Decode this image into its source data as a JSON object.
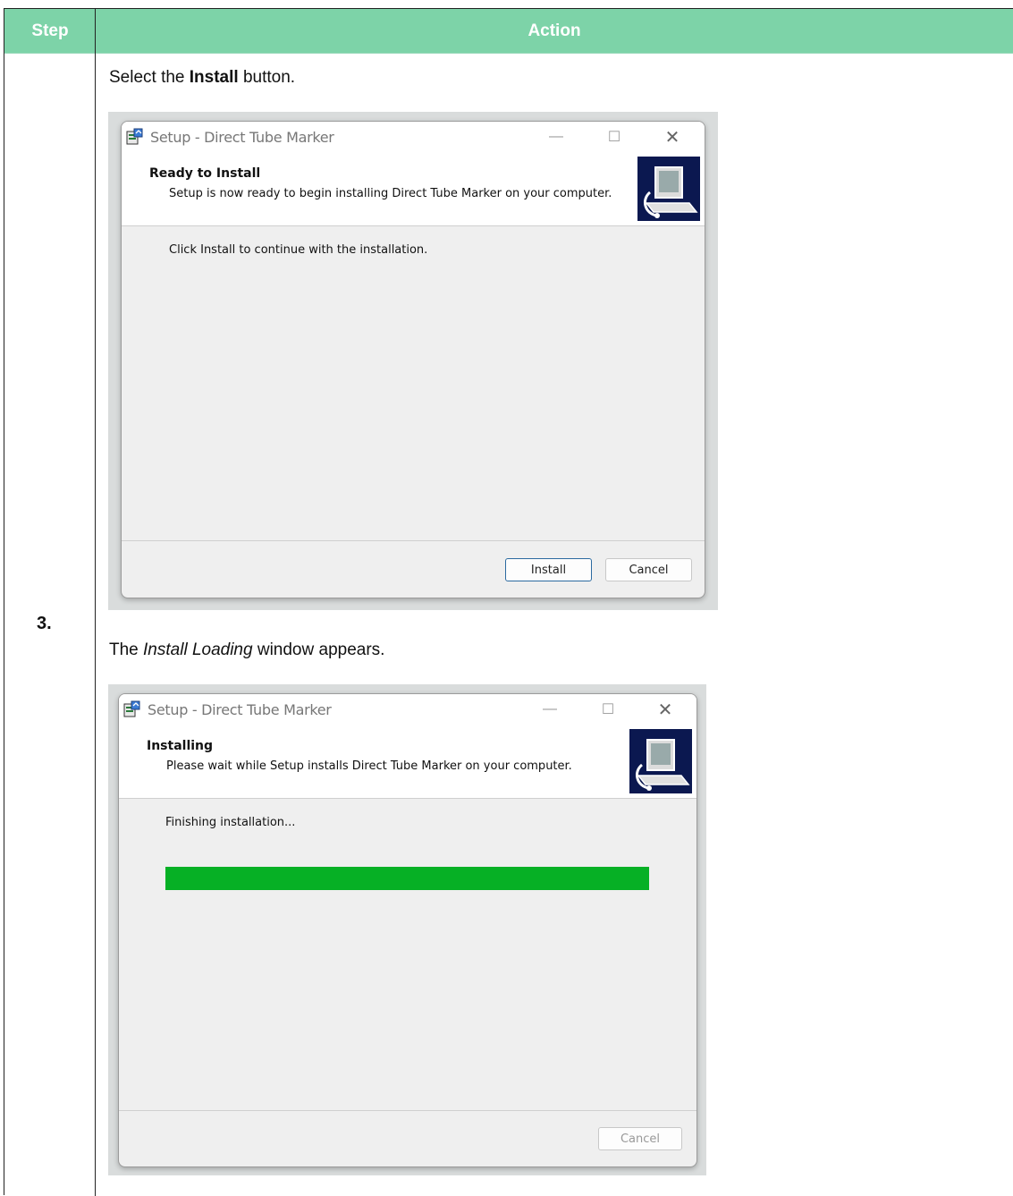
{
  "table": {
    "header_step": "Step",
    "header_action": "Action",
    "step_number": "3."
  },
  "instruction1": {
    "pre": "Select the ",
    "bold": "Install",
    "post": " button."
  },
  "instruction2": {
    "pre": "The ",
    "italic": "Install Loading",
    "post": " window appears."
  },
  "dialog1": {
    "title": "Setup - Direct Tube Marker",
    "heading": "Ready to Install",
    "subheading": "Setup is now ready to begin installing Direct Tube Marker on your computer.",
    "body": "Click Install to continue with the installation.",
    "install_label": "Install",
    "cancel_label": "Cancel"
  },
  "dialog2": {
    "title": "Setup - Direct Tube Marker",
    "heading": "Installing",
    "subheading": "Please wait while Setup installs Direct Tube Marker on your computer.",
    "status": "Finishing installation...",
    "progress": 1.0,
    "cancel_label": "Cancel"
  },
  "icons": {
    "minimize": "minimize-icon",
    "maximize": "maximize-icon",
    "close": "close-icon",
    "setup": "setup-app-icon",
    "banner": "computer-install-icon"
  },
  "colors": {
    "header_bg": "#7dd3a8",
    "progress_fill": "#06b025"
  }
}
